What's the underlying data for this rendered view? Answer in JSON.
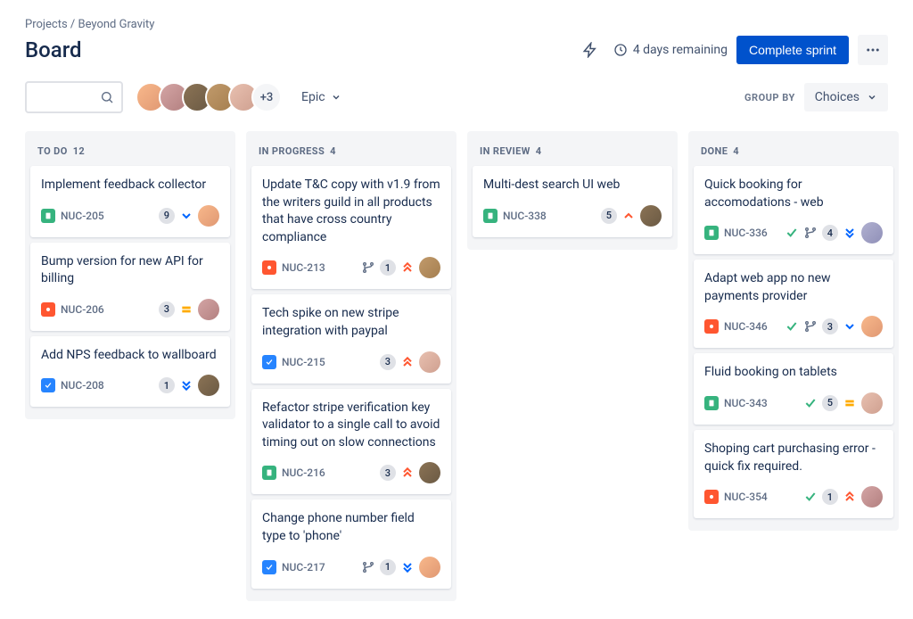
{
  "breadcrumb": {
    "parent": "Projects",
    "current": "Beyond Gravity"
  },
  "page_title": "Board",
  "header": {
    "remaining": "4 days remaining",
    "complete_sprint": "Complete sprint"
  },
  "toolbar": {
    "avatar_more": "+3",
    "epic_label": "Epic",
    "group_by_label": "GROUP BY",
    "group_by_value": "Choices"
  },
  "columns": [
    {
      "title": "TO DO",
      "count": "12"
    },
    {
      "title": "IN PROGRESS",
      "count": "4"
    },
    {
      "title": "IN REVIEW",
      "count": "4"
    },
    {
      "title": "DONE",
      "count": "4"
    }
  ],
  "cards": {
    "c0": {
      "title": "Implement feedback collector",
      "key": "NUC-205",
      "points": "9"
    },
    "c1": {
      "title": "Bump version for new API for billing",
      "key": "NUC-206",
      "points": "3"
    },
    "c2": {
      "title": "Add NPS feedback to wallboard",
      "key": "NUC-208",
      "points": "1"
    },
    "c3": {
      "title": "Update T&C copy with v1.9 from the writers guild in all products that have cross country compliance",
      "key": "NUC-213",
      "points": "1"
    },
    "c4": {
      "title": "Tech spike on new stripe integration with paypal",
      "key": "NUC-215",
      "points": "3"
    },
    "c5": {
      "title": "Refactor stripe verification key validator to a single call to avoid timing out on slow connections",
      "key": "NUC-216",
      "points": "3"
    },
    "c6": {
      "title": "Change phone number field type to 'phone'",
      "key": "NUC-217",
      "points": "1"
    },
    "c7": {
      "title": "Multi-dest search UI web",
      "key": "NUC-338",
      "points": "5"
    },
    "c8": {
      "title": "Quick booking for accomodations - web",
      "key": "NUC-336",
      "points": "4"
    },
    "c9": {
      "title": "Adapt web app no new payments provider",
      "key": "NUC-346",
      "points": "3"
    },
    "c10": {
      "title": "Fluid booking on tablets",
      "key": "NUC-343",
      "points": "5"
    },
    "c11": {
      "title": "Shoping cart purchasing error - quick fix required.",
      "key": "NUC-354",
      "points": "1"
    }
  }
}
